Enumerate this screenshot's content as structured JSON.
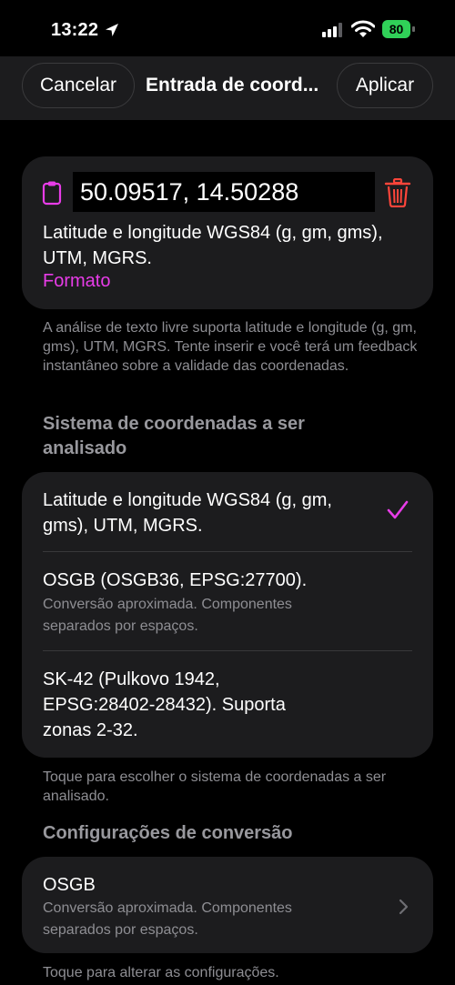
{
  "status": {
    "time": "13:22",
    "battery": "80"
  },
  "nav": {
    "cancel": "Cancelar",
    "title": "Entrada de coord...",
    "apply": "Aplicar"
  },
  "input": {
    "value": "50.09517, 14.50288",
    "detected": "Latitude e longitude WGS84 (g, gm, gms), UTM, MGRS.",
    "format_link": "Formato"
  },
  "help_free_text": "A análise de texto livre suporta latitude e longitude (g, gm, gms), UTM, MGRS. Tente inserir e você terá um feedback instantâneo sobre a validade das coordenadas.",
  "section_system": "Sistema de coordenadas a ser analisado",
  "options": [
    {
      "title": "Latitude e longitude WGS84 (g, gm, gms), UTM, MGRS.",
      "subtitle": "",
      "selected": true
    },
    {
      "title": "OSGB (OSGB36, EPSG:27700).",
      "subtitle": "Conversão aproximada. Componentes separados por espaços.",
      "selected": false
    },
    {
      "title": "SK-42 (Pulkovo 1942, EPSG:28402-28432). Suporta zonas 2-32.",
      "subtitle": "",
      "selected": false
    }
  ],
  "help_system": "Toque para escolher o sistema de coordenadas a ser analisado.",
  "section_conversion": "Configurações de conversão",
  "conversion": {
    "title": "OSGB",
    "subtitle": "Conversão aproximada. Componentes separados por espaços."
  },
  "help_conversion": "Toque para alterar as configurações.",
  "colors": {
    "accent": "#e83ce8",
    "delete": "#ff453a",
    "battery": "#30d158",
    "card": "#1c1c1e"
  },
  "icons": [
    "location-arrow-icon",
    "signal-icon",
    "wifi-icon",
    "battery-icon",
    "clipboard-icon",
    "trash-icon",
    "checkmark-icon",
    "chevron-right-icon"
  ]
}
